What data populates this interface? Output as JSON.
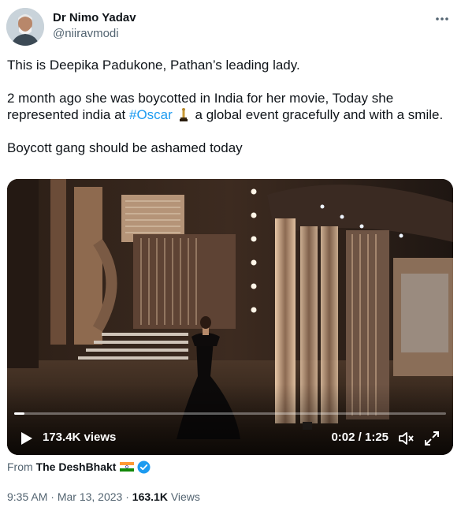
{
  "author": {
    "display_name": "Dr Nimo Yadav",
    "handle": "@niiravmodi"
  },
  "tweet": {
    "line1": "This is Deepika Padukone, Pathan’s leading lady.",
    "line2_prefix": "2 month ago she was boycotted in India for her movie, Today she represented india at ",
    "hashtag": "#Oscar",
    "line2_suffix": " a global event gracefully and with a smile.",
    "line3": "Boycott gang should be ashamed today"
  },
  "video": {
    "views": "173.4K views",
    "time": "0:02 / 1:25",
    "progress": 0.024
  },
  "source": {
    "prefix": "From",
    "app_name": "The DeshBhakt"
  },
  "meta": {
    "time": "9:35 AM",
    "separator": "·",
    "date": "Mar 13, 2023",
    "views_count": "163.1K",
    "views_label": "Views"
  },
  "icons": [
    "more-icon",
    "trophy-icon",
    "play-icon",
    "volume-muted-icon",
    "fullscreen-icon",
    "india-flag-icon",
    "verified-badge-icon"
  ],
  "colors": {
    "link": "#1d9bf0",
    "muted": "#536471",
    "text": "#0f1419",
    "verified": "#1d9bf0"
  }
}
